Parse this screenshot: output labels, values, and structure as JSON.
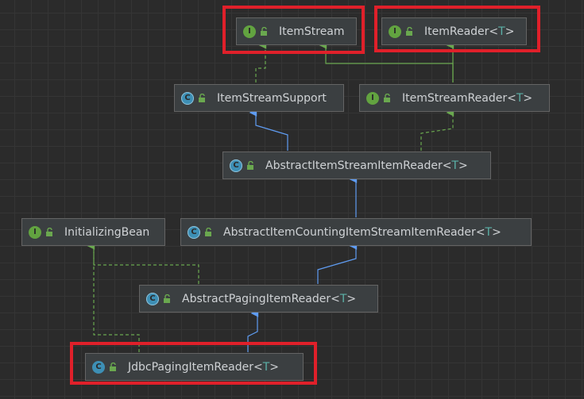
{
  "diagram": {
    "nodes": [
      {
        "id": "item_stream",
        "kind": "interface",
        "icon_letter": "I",
        "name": "ItemStream",
        "type_param": "",
        "highlighted": true
      },
      {
        "id": "item_reader",
        "kind": "interface",
        "icon_letter": "I",
        "name": "ItemReader",
        "type_param": "T",
        "highlighted": true
      },
      {
        "id": "item_stream_support",
        "kind": "abstract-class",
        "icon_letter": "C",
        "name": "ItemStreamSupport",
        "type_param": "",
        "highlighted": false
      },
      {
        "id": "item_stream_reader",
        "kind": "interface",
        "icon_letter": "I",
        "name": "ItemStreamReader",
        "type_param": "T",
        "highlighted": false
      },
      {
        "id": "abstract_item_stream_item_reader",
        "kind": "abstract-class",
        "icon_letter": "C",
        "name": "AbstractItemStreamItemReader",
        "type_param": "T",
        "highlighted": false
      },
      {
        "id": "initializing_bean",
        "kind": "interface",
        "icon_letter": "I",
        "name": "InitializingBean",
        "type_param": "",
        "highlighted": false
      },
      {
        "id": "abstract_item_counting_item_stream_item_reader",
        "kind": "abstract-class",
        "icon_letter": "C",
        "name": "AbstractItemCountingItemStreamItemReader",
        "type_param": "T",
        "highlighted": false
      },
      {
        "id": "abstract_paging_item_reader",
        "kind": "abstract-class",
        "icon_letter": "C",
        "name": "AbstractPagingItemReader",
        "type_param": "T",
        "highlighted": false
      },
      {
        "id": "jdbc_paging_item_reader",
        "kind": "class",
        "icon_letter": "C",
        "name": "JdbcPagingItemReader",
        "type_param": "T",
        "highlighted": true
      }
    ],
    "edges": [
      {
        "from": "item_stream_support",
        "to": "item_stream",
        "relation": "implements"
      },
      {
        "from": "item_stream_reader",
        "to": "item_stream",
        "relation": "extends-interface"
      },
      {
        "from": "item_stream_reader",
        "to": "item_reader",
        "relation": "extends-interface"
      },
      {
        "from": "abstract_item_stream_item_reader",
        "to": "item_stream_support",
        "relation": "extends"
      },
      {
        "from": "abstract_item_stream_item_reader",
        "to": "item_stream_reader",
        "relation": "implements"
      },
      {
        "from": "abstract_item_counting_item_stream_item_reader",
        "to": "abstract_item_stream_item_reader",
        "relation": "extends"
      },
      {
        "from": "abstract_paging_item_reader",
        "to": "abstract_item_counting_item_stream_item_reader",
        "relation": "extends"
      },
      {
        "from": "abstract_paging_item_reader",
        "to": "initializing_bean",
        "relation": "implements"
      },
      {
        "from": "jdbc_paging_item_reader",
        "to": "abstract_paging_item_reader",
        "relation": "extends"
      },
      {
        "from": "jdbc_paging_item_reader",
        "to": "initializing_bean",
        "relation": "implements"
      }
    ]
  },
  "colors": {
    "extends_edge": "#5f9cf2",
    "implements_edge": "#6aa84f",
    "highlight_border": "#e0202a",
    "node_background": "#3b3f41",
    "type_param": "#5bb0a7"
  }
}
